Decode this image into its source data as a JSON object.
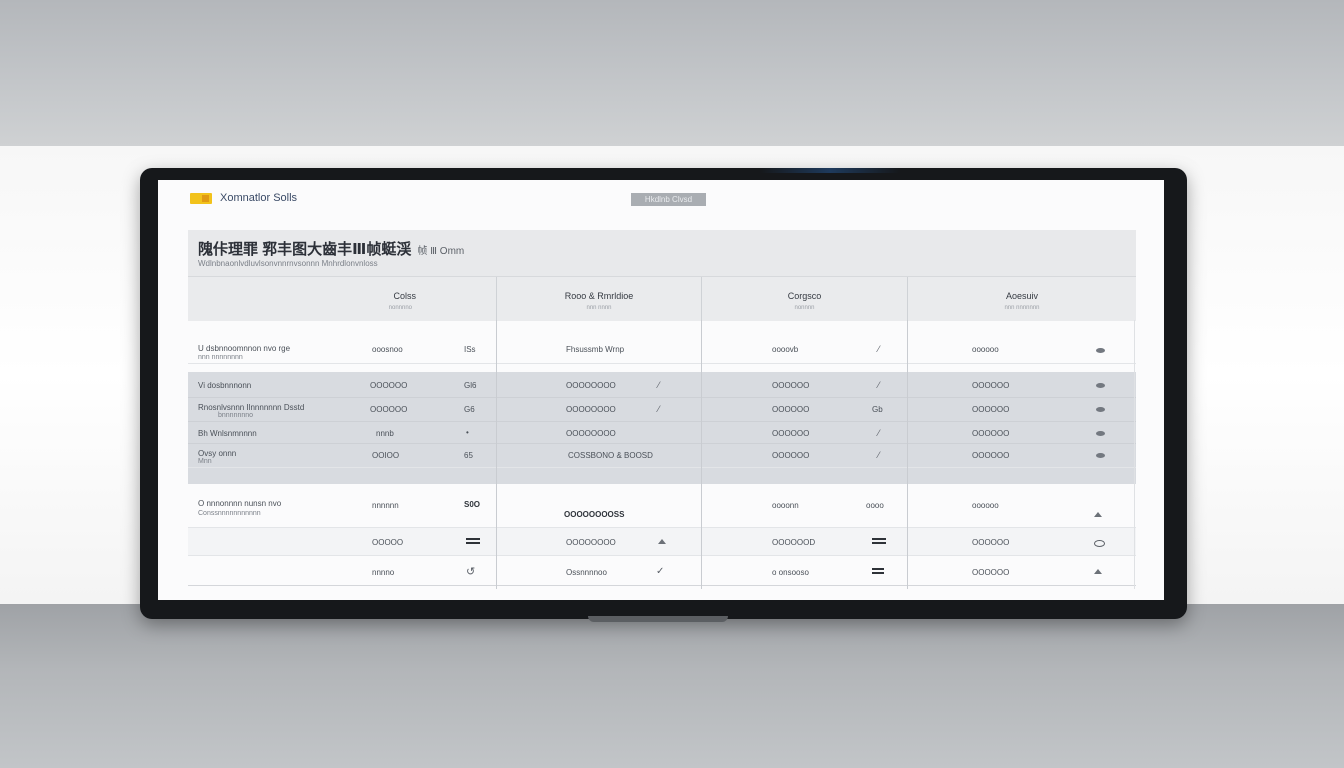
{
  "app": {
    "title": "Xomnatlor Solls",
    "header_badge": "Hkdlnb Clvsd"
  },
  "page": {
    "title": "隗佧理罪 郛丰图大齒丰Ⅲ帧蜓渓",
    "title_suffix": "帧 Ⅲ Omm",
    "subtitle": "Wdlnbnaonlvdluvlsonvnnrnvsonnn Mnhrdlonvnloss"
  },
  "table": {
    "headers": [
      {
        "label": "Colss",
        "sub": "nonnnno"
      },
      {
        "label": "Rooo & Rmrldioe",
        "sub": "nnn nnnn"
      },
      {
        "label": "Corgsco",
        "sub": "nonnnn"
      },
      {
        "label": "Aoesuiv",
        "sub": "nnn nnnnnnn"
      }
    ],
    "rows": [
      {
        "name": "U dsbnnoomnnon nvo rge",
        "sub": "nnn nnnnnnnn",
        "c1": "ooosnoo",
        "c2": "ISs",
        "c3": "Fhsussmb Wrnp",
        "c4": "oooovb",
        "c5": "oooooo"
      },
      {
        "name": "Vi dosbnnnonn",
        "sub": "",
        "c1": "OOOOOO",
        "c2": "Gl6",
        "c3": "OOOOOOOO",
        "c4": "OOOOOO",
        "c5": "OOOOOO"
      },
      {
        "name": "Rnosnlvsnnn Ilnnnnnnn Dsstd",
        "sub": "bnnnnnnno",
        "c1": "OOOOOO",
        "c2": "G6",
        "c3": "OOOOOOOO",
        "c4": "OOOOOO",
        "c5": "OOOOOO",
        "c6": "Gb"
      },
      {
        "name": "Bh Wnlsnmnnnn",
        "sub": "",
        "c1": "nnnb",
        "c2": "•",
        "c3": "OOOOOOOO",
        "c4": "OOOOOO",
        "c5": "OOOOOO"
      },
      {
        "name": "Ovsy onnn",
        "sub": "Mnn",
        "c1": "OOIOO",
        "c2": "65",
        "c3": "COSSBONO & BOOSD",
        "c4": "OOOOOO",
        "c5": "OOOOOO"
      },
      {
        "name": "O nnnonnnn nunsn nvo",
        "sub": "Conssnnnnnnnnnnn",
        "c1": "nnnnnn",
        "c2": "S0O",
        "c3": "OOOOOOOOSS",
        "c4": "oooonn",
        "c5": "oooooo",
        "c6": "oooo"
      },
      {
        "name": "",
        "sub": "",
        "c1": "OOOOO",
        "c2": "",
        "c3": "OOOOOOOO",
        "c4": "OOOOOOD",
        "c5": "OOOOOO"
      },
      {
        "name": "",
        "sub": "",
        "c1": "nnnno",
        "c2": "",
        "c3": "Ossnnnnoo",
        "c4": "o onsooso",
        "c5": "OOOOOO"
      }
    ]
  }
}
